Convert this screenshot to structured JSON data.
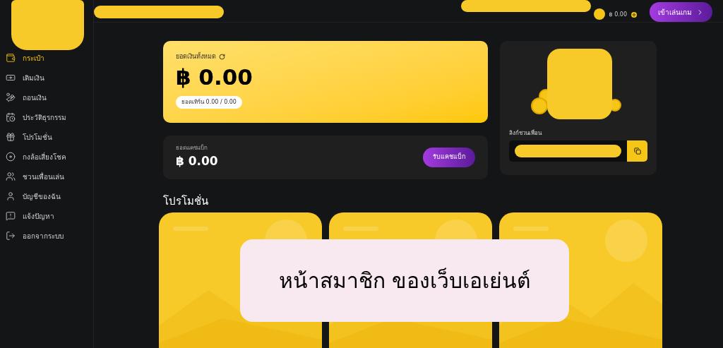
{
  "sidebar": {
    "items": [
      {
        "label": "กระเป๋า",
        "selected": true
      },
      {
        "label": "เติมเงิน",
        "selected": false
      },
      {
        "label": "ถอนเงิน",
        "selected": false
      },
      {
        "label": "ประวัติธุรกรรม",
        "selected": false
      },
      {
        "label": "โปรโมชั่น",
        "selected": false
      },
      {
        "label": "กงล้อเสี่ยงโชค",
        "selected": false
      },
      {
        "label": "ชวนเพื่อนเล่น",
        "selected": false
      },
      {
        "label": "บัญชีของฉัน",
        "selected": false
      },
      {
        "label": "แจ้งปัญหา",
        "selected": false
      },
      {
        "label": "ออกจากระบบ",
        "selected": false
      }
    ]
  },
  "topbar": {
    "balance": "฿ 0.00",
    "play_button": "เข้าเล่นเกม"
  },
  "wallet": {
    "label": "ยอดเงินทั้งหมด",
    "amount": "฿ 0.00",
    "turnover": "ยอดเทิร์น 0.00 / 0.00"
  },
  "cashback": {
    "label": "ยอดแคชแบ็ก",
    "amount": "฿ 0.00",
    "button": "รับแคชแบ็ก"
  },
  "invite": {
    "label": "ลิงก์ชวนเพื่อน"
  },
  "promotions": {
    "title": "โปรโมชั่น"
  },
  "caption": "หน้าสมาชิก ของเว็บเอเย่นต์"
}
